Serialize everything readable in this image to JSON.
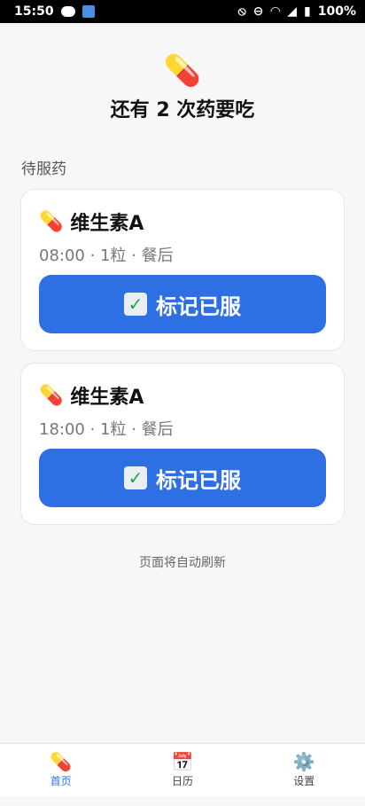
{
  "status_bar": {
    "time": "15:50",
    "battery": "100%"
  },
  "header": {
    "icon": "pill-icon",
    "title": "还有 2 次药要吃"
  },
  "section": {
    "label": "待服药"
  },
  "medications": [
    {
      "name": "维生素A",
      "details": "08:00 · 1粒 · 餐后",
      "button_label": "标记已服"
    },
    {
      "name": "维生素A",
      "details": "18:00 · 1粒 · 餐后",
      "button_label": "标记已服"
    }
  ],
  "footer_note": "页面将自动刷新",
  "bottom_nav": {
    "items": [
      {
        "label": "首页",
        "icon": "pill-icon",
        "active": true
      },
      {
        "label": "日历",
        "icon": "calendar-icon",
        "active": false
      },
      {
        "label": "设置",
        "icon": "gear-icon",
        "active": false
      }
    ]
  },
  "colors": {
    "accent": "#2f6fe4",
    "background": "#f7f7f7"
  }
}
